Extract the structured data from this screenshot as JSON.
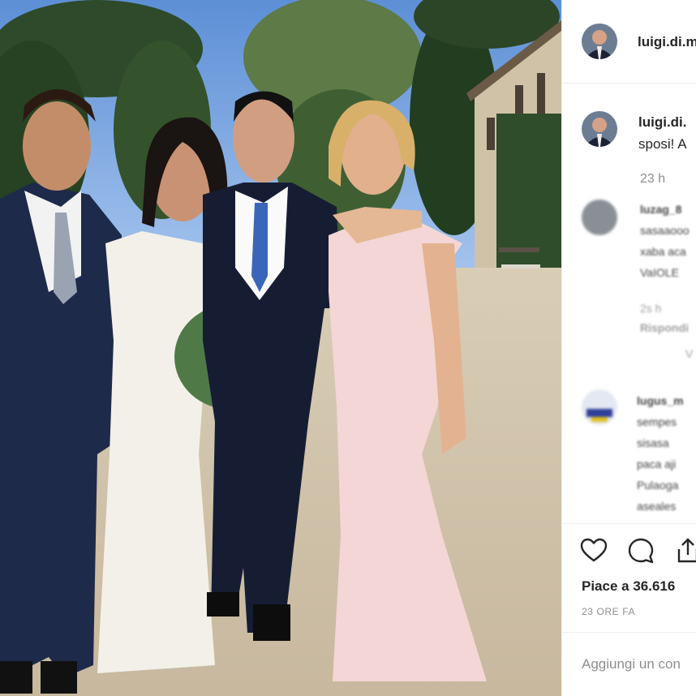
{
  "post": {
    "username": "luigi.di.m",
    "photo_alt": "Photo",
    "caption_user": "luigi.di.",
    "caption_text": "sposi! A",
    "caption_time": "23 h"
  },
  "comments": [
    {
      "user": "luzag_8",
      "lines": [
        "sasaaooo",
        "xaba aca",
        "VaIOLE"
      ],
      "time": "2s h",
      "reply": "Rispondi",
      "more": "V"
    },
    {
      "user": "lugus_m",
      "lines": [
        "sempes",
        "sisasa",
        "paca aji",
        "Pulaoga",
        "aseales"
      ]
    }
  ],
  "actions": {
    "like_icon": "heart-icon",
    "comment_icon": "comment-icon",
    "share_icon": "share-icon",
    "likes": "Piace a 36.616",
    "ago": "23 ORE FA"
  },
  "add_comment": {
    "placeholder": "Aggiungi un con"
  },
  "colors": {
    "text": "#262626",
    "muted": "#8e8e8e",
    "border": "#efefef"
  }
}
